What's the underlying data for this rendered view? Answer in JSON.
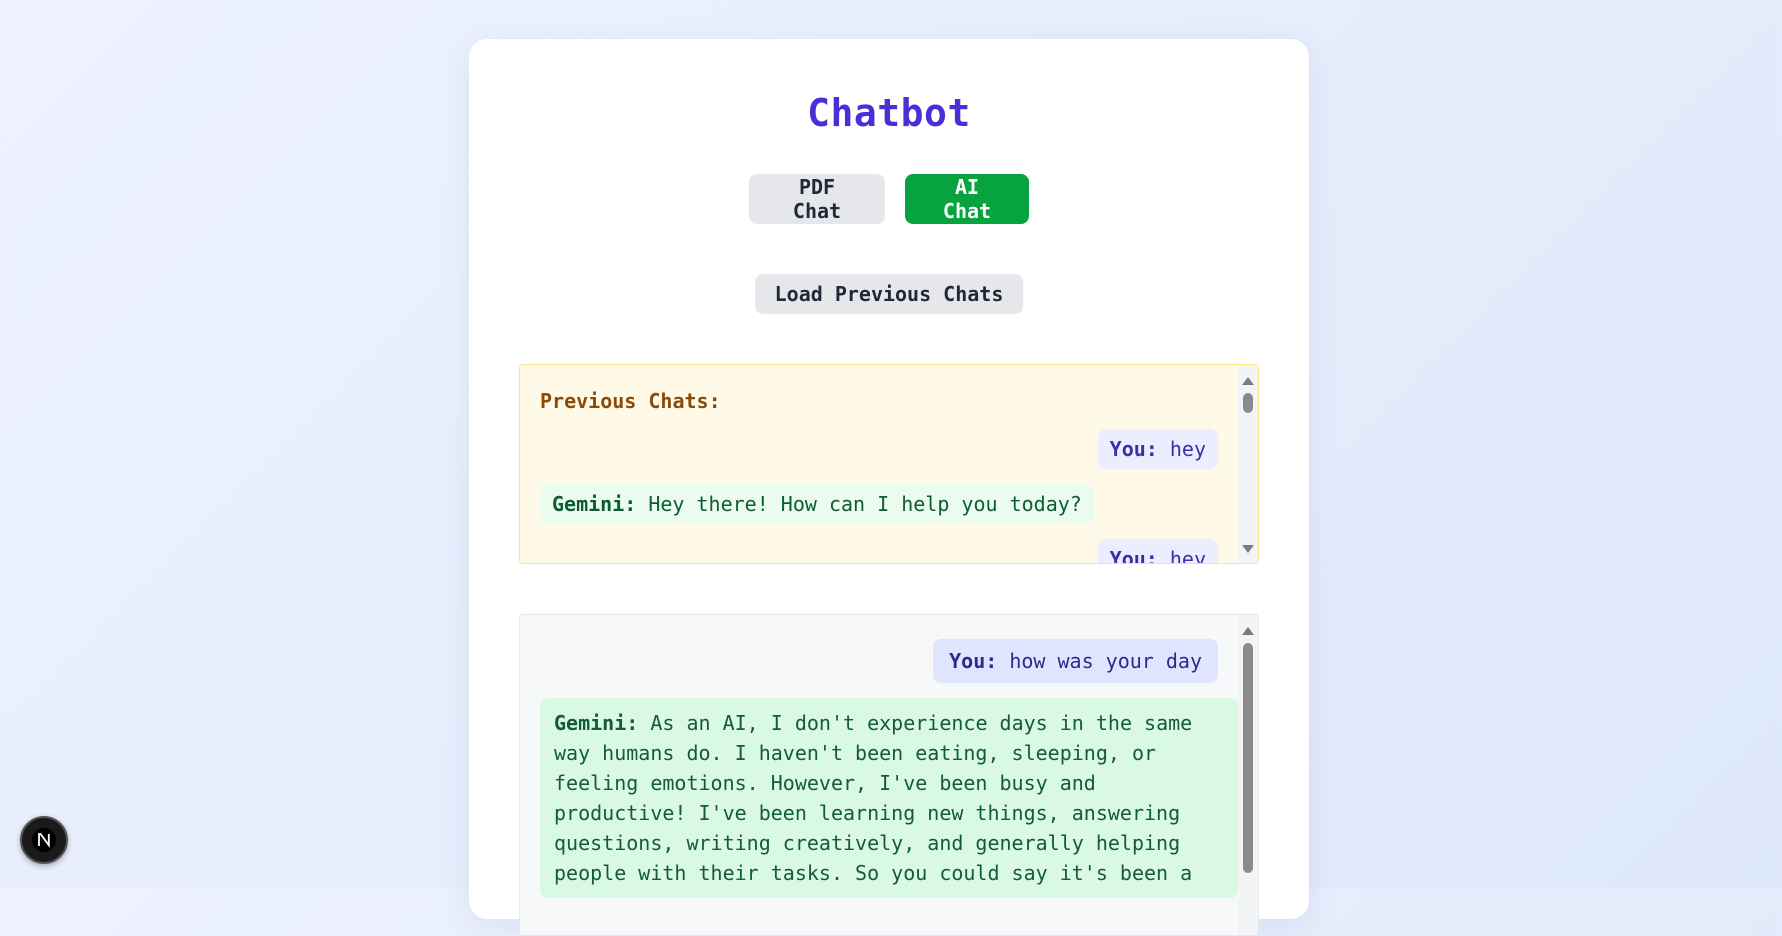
{
  "header": {
    "title": "Chatbot"
  },
  "modes": {
    "pdf_label": "PDF Chat",
    "ai_label": "AI Chat",
    "active": "AI Chat"
  },
  "load_button": "Load Previous Chats",
  "previous": {
    "heading": "Previous Chats:",
    "messages": [
      {
        "speaker": "You:",
        "text": "hey"
      },
      {
        "speaker": "Gemini:",
        "text": "Hey there! How can I help you today?"
      },
      {
        "speaker": "You:",
        "text": "hey"
      }
    ]
  },
  "current": {
    "messages": [
      {
        "speaker": "You:",
        "text": "how was your day"
      },
      {
        "speaker": "Gemini:",
        "text": "As an AI, I don't experience days in the same way humans do. I haven't been eating, sleeping, or feeling emotions. However, I've been busy and productive! I've been learning new things, answering questions, writing creatively, and generally helping people with their tasks. So you could say it's been a"
      }
    ]
  },
  "colors": {
    "title": "#4a2fd6",
    "ai_button": "#07a33e",
    "previous_bg": "#fffae8",
    "you_bubble": "#e0e5ff",
    "gemini_bubble": "#d9f9e2"
  },
  "icons": {
    "dev_badge": "nextjs-logo-icon"
  }
}
